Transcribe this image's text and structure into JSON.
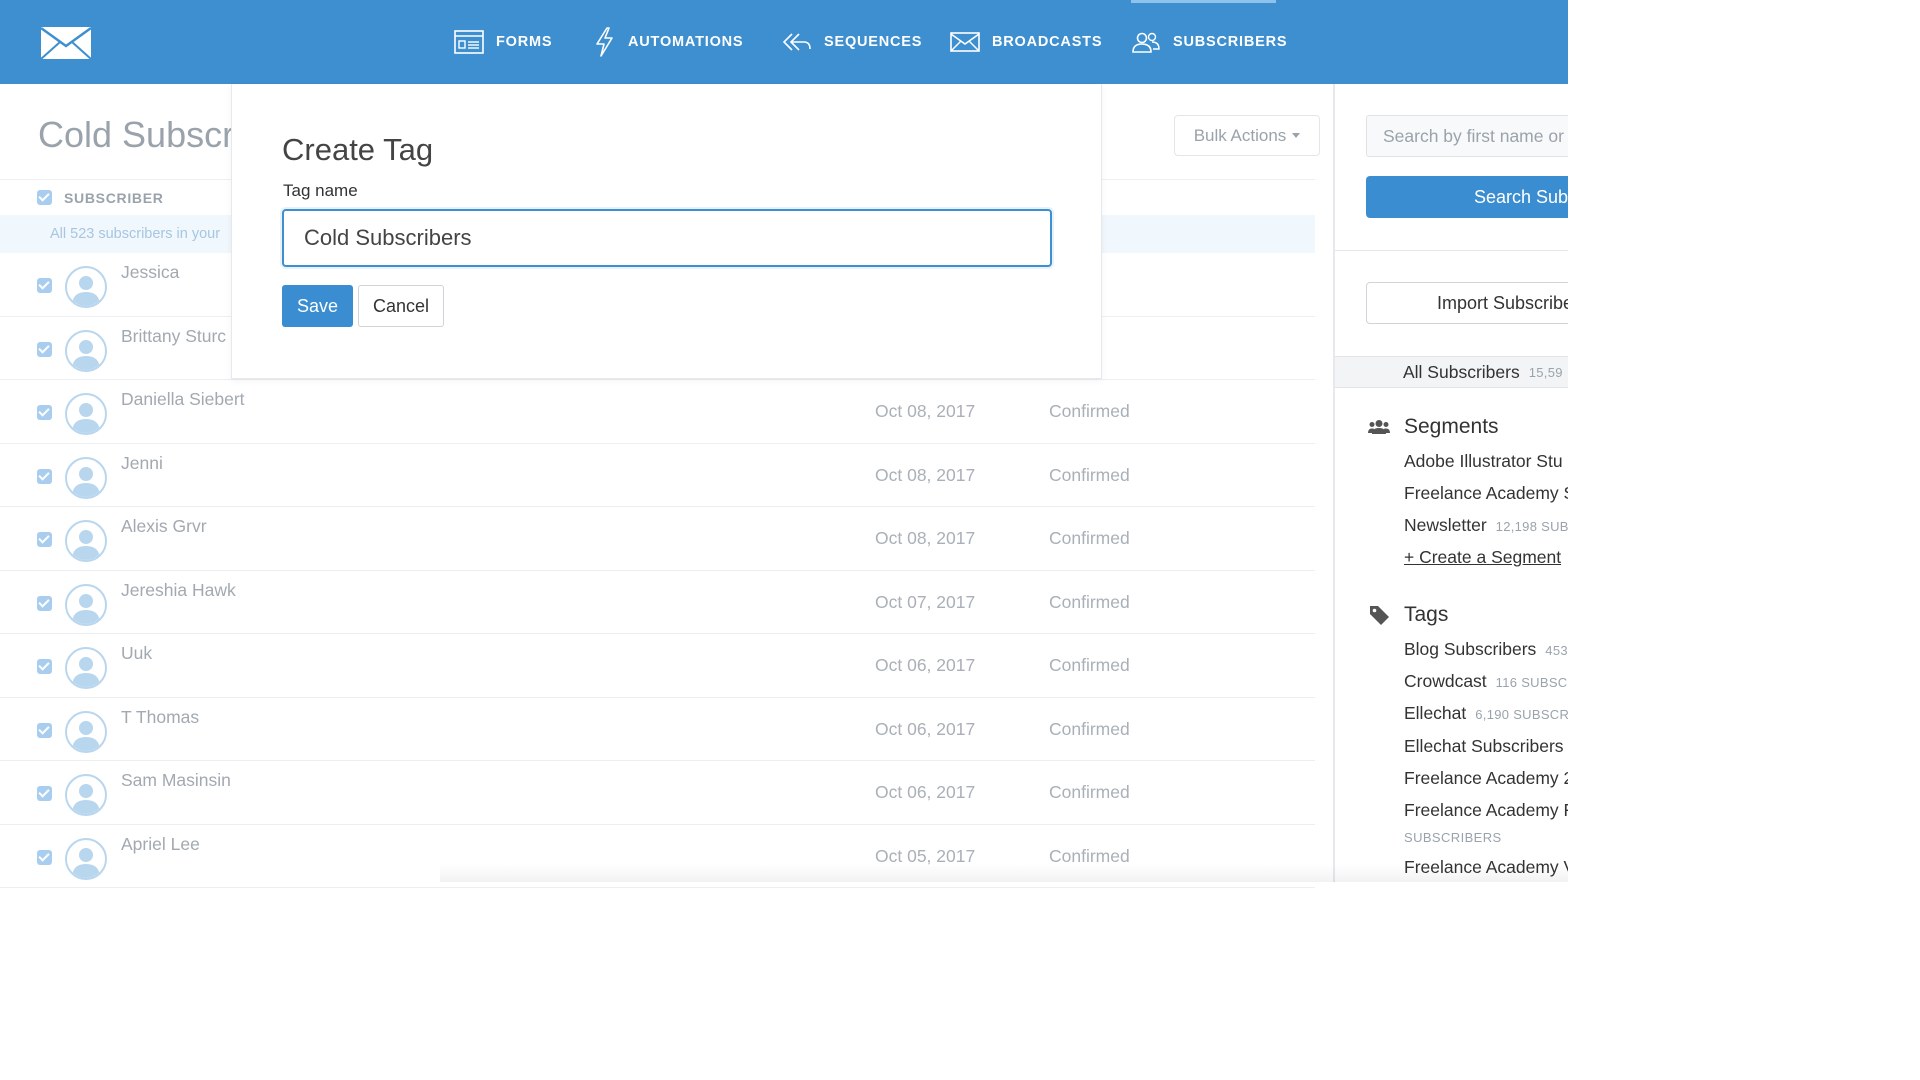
{
  "nav": {
    "items": [
      {
        "label": "FORMS",
        "icon": "forms-icon"
      },
      {
        "label": "AUTOMATIONS",
        "icon": "lightning-icon"
      },
      {
        "label": "SEQUENCES",
        "icon": "sequences-icon"
      },
      {
        "label": "BROADCASTS",
        "icon": "envelope-icon"
      },
      {
        "label": "SUBSCRIBERS",
        "icon": "users-icon"
      }
    ],
    "active": "SUBSCRIBERS"
  },
  "page": {
    "title": "Cold Subscri",
    "bulk_actions_label": "Bulk Actions"
  },
  "table": {
    "header_label": "SUBSCRIBER",
    "notice": "All 523 subscribers in your",
    "rows": [
      {
        "name": "Jessica",
        "date": "",
        "status": "med"
      },
      {
        "name": "Brittany Sturc",
        "date": "",
        "status": "med"
      },
      {
        "name": "Daniella Siebert",
        "date": "Oct 08, 2017",
        "status": "Confirmed"
      },
      {
        "name": "Jenni",
        "date": "Oct 08, 2017",
        "status": "Confirmed"
      },
      {
        "name": "Alexis Grvr",
        "date": "Oct 08, 2017",
        "status": "Confirmed"
      },
      {
        "name": "Jereshia Hawk",
        "date": "Oct 07, 2017",
        "status": "Confirmed"
      },
      {
        "name": "Uuk",
        "date": "Oct 06, 2017",
        "status": "Confirmed"
      },
      {
        "name": "T Thomas",
        "date": "Oct 06, 2017",
        "status": "Confirmed"
      },
      {
        "name": "Sam Masinsin",
        "date": "Oct 06, 2017",
        "status": "Confirmed"
      },
      {
        "name": "Apriel Lee",
        "date": "Oct 05, 2017",
        "status": "Confirmed"
      }
    ]
  },
  "modal": {
    "title": "Create Tag",
    "field_label": "Tag name",
    "field_value": "Cold Subscribers",
    "save_label": "Save",
    "cancel_label": "Cancel"
  },
  "sidebar": {
    "search_placeholder": "Search by first name or",
    "search_button": "Search Subs",
    "import_button": "Import Subscribe",
    "all_subscribers": {
      "label": "All Subscribers",
      "count": "15,59"
    },
    "segments": {
      "heading": "Segments",
      "items": [
        {
          "label": "Adobe Illustrator Stu",
          "count": ""
        },
        {
          "label": "Freelance Academy S",
          "count": ""
        },
        {
          "label": "Newsletter",
          "count": "12,198 SUB"
        }
      ],
      "create_link": "+ Create a Segment"
    },
    "tags": {
      "heading": "Tags",
      "items": [
        {
          "label": "Blog Subscribers",
          "count": "453"
        },
        {
          "label": "Crowdcast",
          "count": "116 SUBSC"
        },
        {
          "label": "Ellechat",
          "count": "6,190 SUBSCR"
        },
        {
          "label": "Ellechat Subscribers",
          "count": ""
        },
        {
          "label": "Freelance Academy 2",
          "count": ""
        },
        {
          "label": "Freelance Academy F",
          "count": ""
        },
        {
          "label": "Freelance Academy V",
          "count": ""
        }
      ],
      "sub_label": "SUBSCRIBERS"
    }
  },
  "colors": {
    "brand_blue": "#3d8fd0",
    "checkbox": "#a9cdee"
  }
}
